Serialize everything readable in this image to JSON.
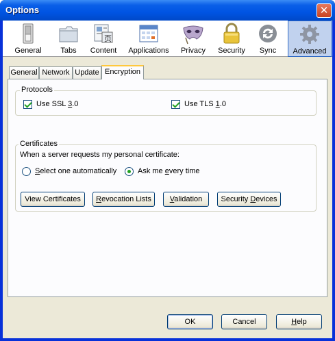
{
  "window": {
    "title": "Options"
  },
  "toolbar": {
    "items": [
      {
        "label": "General",
        "icon": "switch-icon"
      },
      {
        "label": "Tabs",
        "icon": "folder-tabs-icon"
      },
      {
        "label": "Content",
        "icon": "content-page-icon"
      },
      {
        "label": "Applications",
        "icon": "applications-calendar-icon"
      },
      {
        "label": "Privacy",
        "icon": "mask-icon"
      },
      {
        "label": "Security",
        "icon": "padlock-icon"
      },
      {
        "label": "Sync",
        "icon": "sync-arrows-icon"
      },
      {
        "label": "Advanced",
        "icon": "gear-icon"
      }
    ],
    "selected": "Advanced"
  },
  "tabs": [
    {
      "label": "General"
    },
    {
      "label": "Network"
    },
    {
      "label": "Update"
    },
    {
      "label": "Encryption"
    }
  ],
  "active_tab": "Encryption",
  "protocols": {
    "title": "Protocols",
    "ssl": {
      "label_pre": "Use SSL ",
      "label_u": "3",
      "label_post": ".0",
      "checked": true
    },
    "tls": {
      "label_pre": "Use TLS ",
      "label_u": "1",
      "label_post": ".0",
      "checked": true
    }
  },
  "certificates": {
    "title": "Certificates",
    "prompt": "When a server requests my personal certificate:",
    "option_auto": {
      "label_u": "S",
      "label_rest": "elect one automatically",
      "selected": false
    },
    "option_ask": {
      "label_pre": "Ask me ",
      "label_u": "e",
      "label_rest": "very time",
      "selected": true
    },
    "buttons": {
      "view": {
        "pre": "View Certificates",
        "u": "",
        "post": ""
      },
      "revocation": {
        "pre": "",
        "u": "R",
        "post": "evocation Lists"
      },
      "validation": {
        "pre": "",
        "u": "V",
        "post": "alidation"
      },
      "devices": {
        "pre": "Security ",
        "u": "D",
        "post": "evices"
      }
    }
  },
  "footer": {
    "ok": "OK",
    "cancel": "Cancel",
    "help": {
      "u": "H",
      "rest": "elp"
    }
  },
  "colors": {
    "title_bar": "#0054e3",
    "selection": "#c1d2ee",
    "check": "#21a121"
  }
}
